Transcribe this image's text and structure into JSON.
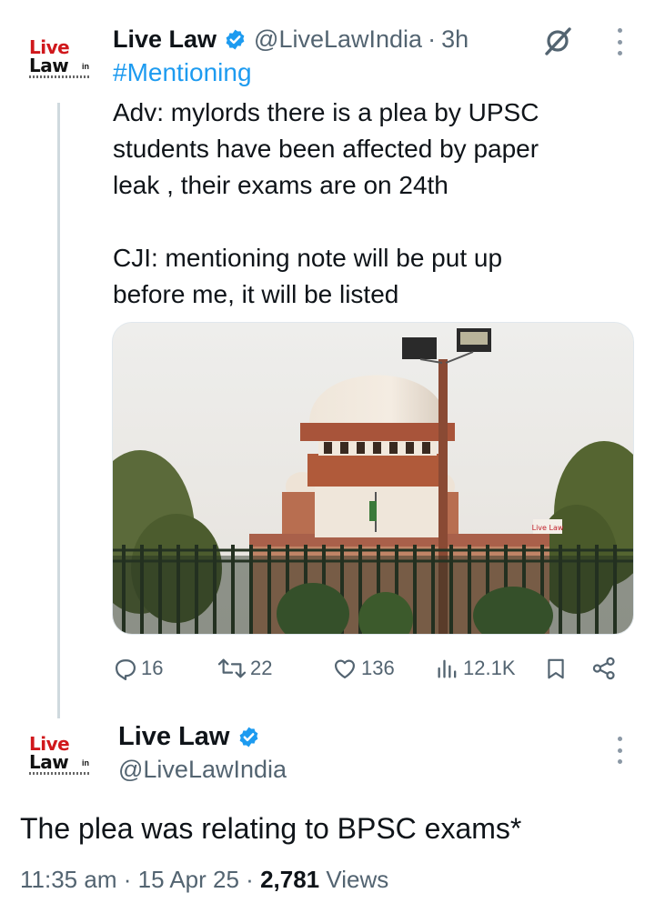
{
  "tweet1": {
    "avatar": {
      "line1": "Live",
      "line2": "Law",
      "suffix": "in"
    },
    "name": "Live Law",
    "handle": "@LiveLawIndia",
    "separator": "·",
    "time": "3h",
    "hashtag": "#Mentioning",
    "text": "Adv: mylords there is a plea by UPSC\nstudents have been affected by paper\nleak , their exams are on 24th\n\nCJI: mentioning note will be put up\nbefore me, it will be listed",
    "image_watermark": "Live Law",
    "actions": {
      "replies": "16",
      "reposts": "22",
      "likes": "136",
      "views": "12.1K"
    }
  },
  "tweet2": {
    "avatar": {
      "line1": "Live",
      "line2": "Law",
      "suffix": "in"
    },
    "name": "Live Law",
    "handle": "@LiveLawIndia",
    "text": "The plea was relating to BPSC exams*",
    "time": "11:35 am",
    "date": "15 Apr 25",
    "separator": "·",
    "views_count": "2,781",
    "views_label": "Views"
  },
  "colors": {
    "accent": "#1d9bf0",
    "secondary_text": "#536471",
    "brand_red": "#d0181c",
    "thread_line": "#cfd9de"
  },
  "icons": [
    "verified-icon",
    "grok-icon",
    "more-icon",
    "reply-icon",
    "repost-icon",
    "like-icon",
    "views-icon",
    "bookmark-icon",
    "share-icon"
  ]
}
